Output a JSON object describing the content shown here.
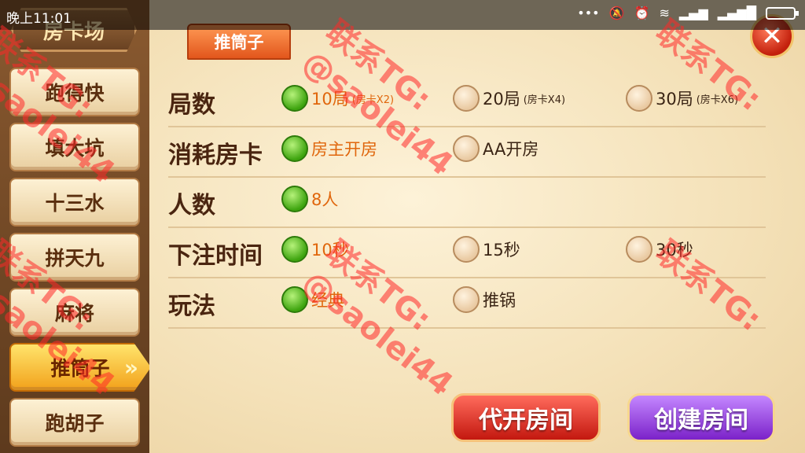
{
  "status_bar": {
    "time": "晚上11:01",
    "icons": [
      "dots-icon",
      "mute-icon",
      "alarm-icon",
      "wifi-icon",
      "signal-icon",
      "signal-4g-icon",
      "battery-icon"
    ]
  },
  "sidebar": {
    "title": "房卡场",
    "items": [
      {
        "label": "跑得快"
      },
      {
        "label": "填大坑"
      },
      {
        "label": "十三水"
      },
      {
        "label": "拼天九"
      },
      {
        "label": "麻将"
      },
      {
        "label": "推筒子"
      },
      {
        "label": "跑胡子"
      }
    ],
    "active_index": 5
  },
  "tab": {
    "label": "推筒子"
  },
  "rows": [
    {
      "label": "局数",
      "options": [
        {
          "text": "10局",
          "sub": "(房卡X2)",
          "selected": true
        },
        {
          "text": "20局",
          "sub": "(房卡X4)",
          "selected": false
        },
        {
          "text": "30局",
          "sub": "(房卡X6)",
          "selected": false
        }
      ]
    },
    {
      "label": "消耗房卡",
      "options": [
        {
          "text": "房主开房",
          "selected": true
        },
        {
          "text": "AA开房",
          "selected": false
        }
      ]
    },
    {
      "label": "人数",
      "options": [
        {
          "text": "8人",
          "selected": true
        }
      ]
    },
    {
      "label": "下注时间",
      "options": [
        {
          "text": "10秒",
          "selected": true
        },
        {
          "text": "15秒",
          "selected": false
        },
        {
          "text": "30秒",
          "selected": false
        }
      ]
    },
    {
      "label": "玩法",
      "options": [
        {
          "text": "经典",
          "selected": true
        },
        {
          "text": "推锅",
          "selected": false
        }
      ]
    }
  ],
  "buttons": {
    "proxy_open": "代开房间",
    "create": "创建房间"
  },
  "watermark": {
    "line1": "联系TG:",
    "line2": "@saolei44"
  },
  "colors": {
    "selected_radio": "#3ea40f",
    "selected_text": "#e0660c",
    "active_tab": "#e2561c",
    "watermark": "#ff2828"
  }
}
